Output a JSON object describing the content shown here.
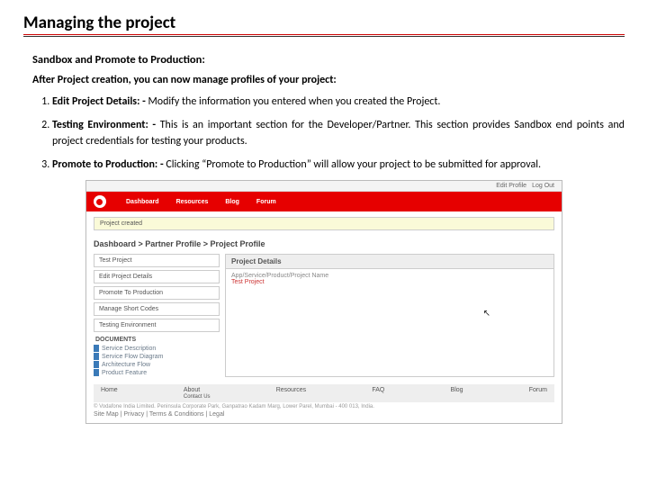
{
  "title": "Managing the project",
  "subtitle": "Sandbox and Promote to Production:",
  "intro": "After Project creation, you can now manage profiles of your project:",
  "items": [
    {
      "label": "Edit Project Details: -",
      "text": "Modify the information you entered when you created the Project."
    },
    {
      "label": "Testing Environment: -",
      "text": "This is an important section for the Developer/Partner. This section provides Sandbox end points and project credentials for testing your products."
    },
    {
      "label": "Promote to Production: -",
      "text": "Clicking “Promote to Production” will allow your project to be submitted for approval."
    }
  ],
  "ui": {
    "top": {
      "edit": "Edit Profile",
      "logout": "Log Out"
    },
    "nav": [
      "Dashboard",
      "Resources",
      "Blog",
      "Forum"
    ],
    "alert": "Project created",
    "breadcrumb": "Dashboard > Partner Profile > Project Profile",
    "side": [
      "Test Project",
      "Edit Project Details",
      "Promote To Production",
      "Manage Short Codes",
      "Testing Environment"
    ],
    "docs_hd": "DOCUMENTS",
    "docs": [
      "Service Description",
      "Service Flow Diagram",
      "Architecture Flow",
      "Product Feature"
    ],
    "panel_hd": "Project Details",
    "panel_lbl": "App/Service/Product/Project Name",
    "panel_val": "Test Project",
    "footer": [
      "Home",
      "About",
      "Resources",
      "FAQ",
      "Blog",
      "Forum"
    ],
    "about_sub": "Contact Us",
    "copyright": "© Vodafone India Limited. Peninsula Corporate Park, Ganpatrao Kadam Marg, Lower Parel, Mumbai - 400 013, India.",
    "footlinks": "Site Map   |   Privacy   |   Terms & Conditions   |   Legal"
  }
}
